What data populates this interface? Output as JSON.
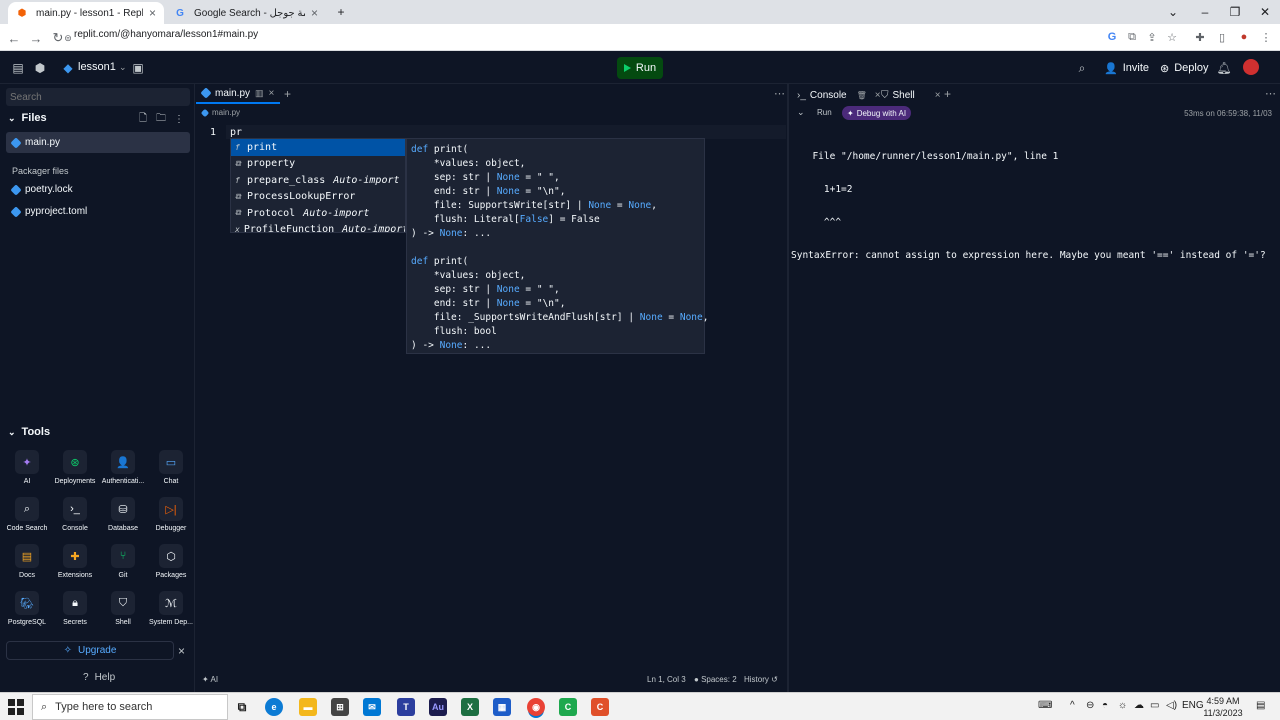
{
  "browser": {
    "tabs": [
      {
        "title": "main.py - lesson1 - Replit",
        "active": true
      },
      {
        "title": "Google Search - ترجمة جوجل",
        "active": false
      }
    ],
    "url": "replit.com/@hanyomara/lesson1#main.py"
  },
  "header": {
    "repl_name": "lesson1",
    "run_label": "Run",
    "invite_label": "Invite",
    "deploy_label": "Deploy"
  },
  "sidebar": {
    "search_placeholder": "Search",
    "files_heading": "Files",
    "files": [
      "main.py"
    ],
    "packager_heading": "Packager files",
    "packager_files": [
      "poetry.lock",
      "pyproject.toml"
    ],
    "tools_heading": "Tools",
    "tools": [
      "AI",
      "Deployments",
      "Authenticati...",
      "Chat",
      "Code Search",
      "Console",
      "Database",
      "Debugger",
      "Docs",
      "Extensions",
      "Git",
      "Packages",
      "PostgreSQL",
      "Secrets",
      "Shell",
      "System Dep..."
    ],
    "upgrade_label": "Upgrade",
    "help_label": "Help"
  },
  "editor": {
    "tab": "main.py",
    "breadcrumb": "main.py",
    "line_number": "1",
    "code": "pr",
    "suggestions": [
      {
        "kind": "f",
        "text": "print",
        "auto": ""
      },
      {
        "kind": "⧉",
        "text": "property",
        "auto": ""
      },
      {
        "kind": "f",
        "text": "prepare_class",
        "auto": "Auto-import"
      },
      {
        "kind": "⧉",
        "text": "ProcessLookupError",
        "auto": ""
      },
      {
        "kind": "⧉",
        "text": "Protocol",
        "auto": "Auto-import"
      },
      {
        "kind": "x",
        "text": "ProfileFunction",
        "auto": "Auto-import"
      }
    ],
    "status": {
      "ai": "AI",
      "position": "Ln 1, Col 3",
      "spaces": "Spaces: 2",
      "history": "History"
    }
  },
  "console": {
    "tab_console": "Console",
    "tab_shell": "Shell",
    "run_label": "Run",
    "debug_label": "Debug with AI",
    "timestamp": "53ms on 06:59:38, 11/03",
    "output": [
      "  File \"/home/runner/lesson1/main.py\", line 1",
      "    1+1=2",
      "    ^^^",
      "SyntaxError: cannot assign to expression here. Maybe you meant '==' instead of '='?"
    ]
  },
  "taskbar": {
    "search_placeholder": "Type here to search",
    "lang": "ENG",
    "time": "4:59 AM",
    "date": "11/3/2023"
  },
  "colors": {
    "accent": "#0079f2",
    "run_green": "#0cce6b",
    "bg": "#0e1525",
    "panel": "#1c2333"
  }
}
